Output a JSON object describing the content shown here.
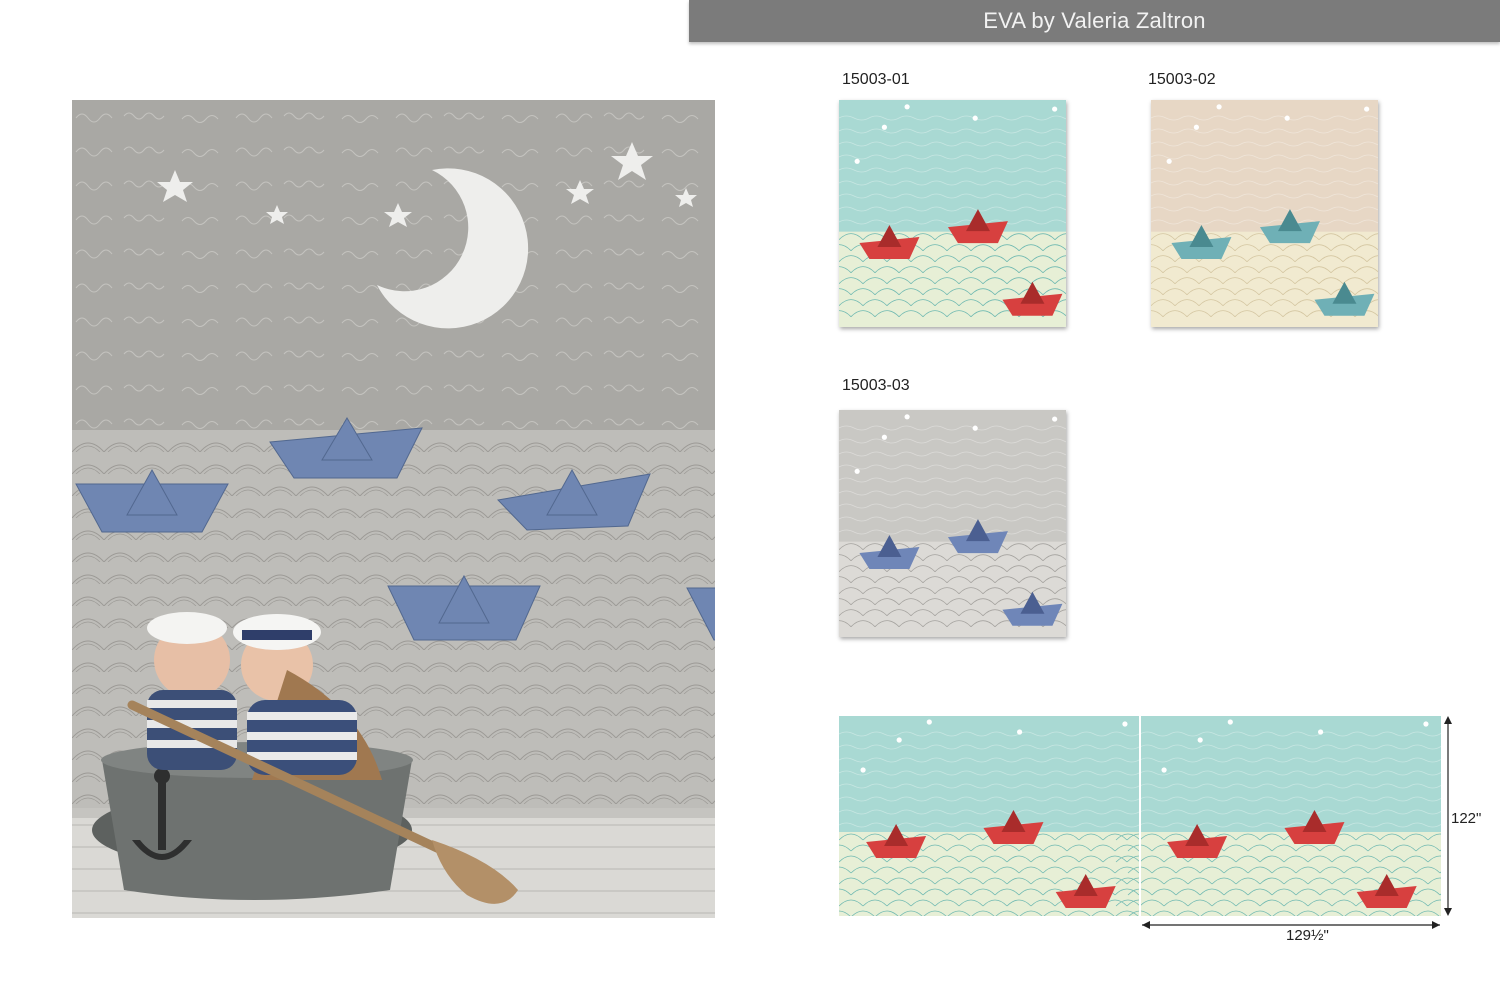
{
  "header": {
    "title": "EVA  by Valeria Zaltron"
  },
  "variants": [
    {
      "code": "15003-01",
      "sky": "#a9d9d3",
      "sea": "#e7efd6",
      "wave": "#6fb9b1",
      "boat": "#d7403f",
      "boat_dark": "#a92c2b"
    },
    {
      "code": "15003-02",
      "sky": "#e7d7c5",
      "sea": "#f1ead0",
      "wave": "#d4c6a1",
      "boat": "#6fb0b6",
      "boat_dark": "#4a8a90"
    },
    {
      "code": "15003-03",
      "sky": "#c9c8c4",
      "sea": "#dcdad6",
      "wave": "#a5a39f",
      "boat": "#6f86b8",
      "boat_dark": "#4b5f91"
    }
  ],
  "panel": {
    "width_label": "129½\"",
    "height_label": "122\""
  },
  "room": {
    "wall": "#a9a8a4",
    "sea": "#bfbdb9",
    "floor": "#d9d8d4",
    "boat": "#6f86b2"
  }
}
